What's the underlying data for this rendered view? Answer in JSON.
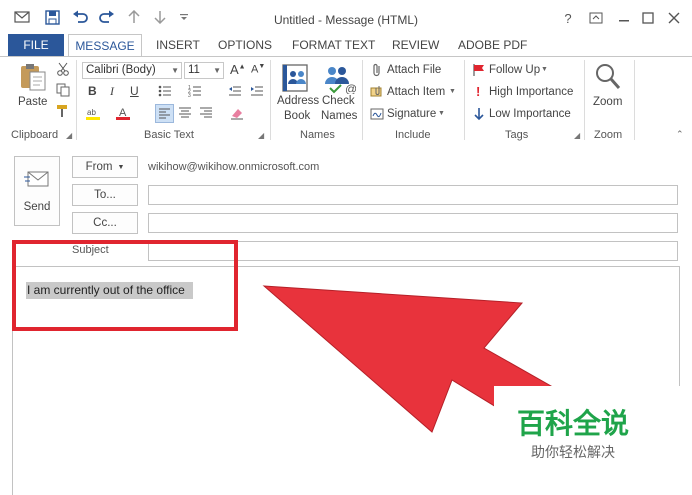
{
  "window": {
    "title": "Untitled - Message (HTML)",
    "controls": {
      "help": "?",
      "restore_ribbon": "⊡",
      "minimize": "—",
      "maximize": "☐",
      "close": "✕"
    }
  },
  "tabs": [
    "FILE",
    "MESSAGE",
    "INSERT",
    "OPTIONS",
    "FORMAT TEXT",
    "REVIEW",
    "ADOBE PDF"
  ],
  "ribbon": {
    "clipboard": {
      "paste": "Paste",
      "label": "Clipboard"
    },
    "basic_text": {
      "font": "Calibri (Body)",
      "size": "11",
      "bold": "B",
      "italic": "I",
      "underline": "U",
      "label": "Basic Text"
    },
    "names": {
      "address_book_1": "Address",
      "address_book_2": "Book",
      "check_names_1": "Check",
      "check_names_2": "Names",
      "label": "Names"
    },
    "include": {
      "attach_file": "Attach File",
      "attach_item": "Attach Item",
      "signature": "Signature",
      "label": "Include"
    },
    "tags": {
      "follow_up": "Follow Up",
      "high_importance": "High Importance",
      "low_importance": "Low Importance",
      "label": "Tags"
    },
    "zoom": {
      "zoom": "Zoom",
      "label": "Zoom"
    }
  },
  "compose": {
    "send": "Send",
    "from_label": "From",
    "from_value": "wikihow@wikihow.onmicrosoft.com",
    "to_label": "To...",
    "cc_label": "Cc...",
    "subject_label": "Subject",
    "body_text": "I am currently out of the office"
  },
  "annotation": {
    "highlight_color": "#e0252f",
    "arrow_color": "#e8333c"
  },
  "watermark": {
    "title": "百科全说",
    "subtitle": "助你轻松解决",
    "color": "#1fa44a"
  },
  "icons": [
    "save-icon",
    "undo-icon",
    "redo-icon",
    "up-arrow-icon",
    "down-arrow-icon",
    "paste-icon",
    "scissors-icon",
    "copy-icon",
    "format-painter-icon",
    "address-book-icon",
    "check-names-icon",
    "paperclip-icon",
    "attach-item-icon",
    "signature-icon",
    "flag-icon",
    "high-importance-icon",
    "low-importance-icon",
    "zoom-magnifier-icon",
    "send-icon"
  ]
}
